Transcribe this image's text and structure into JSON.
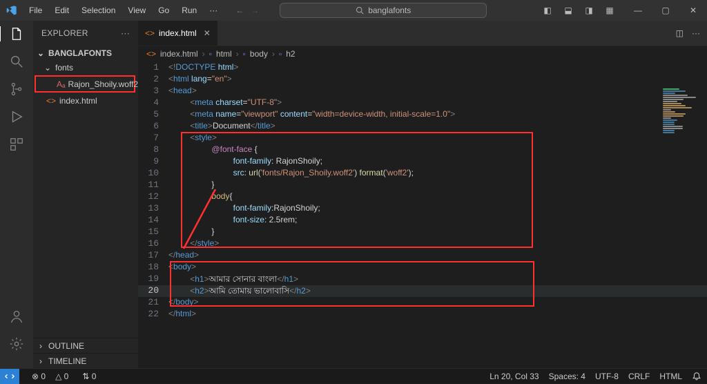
{
  "titlebar": {
    "menu": [
      "File",
      "Edit",
      "Selection",
      "View",
      "Go",
      "Run",
      "···"
    ],
    "search_label": "banglafonts"
  },
  "explorer": {
    "title": "EXPLORER",
    "project": "BANGLAFONTS",
    "folder": "fonts",
    "file1": "Rajon_Shoily.woff2",
    "file2": "index.html",
    "outline": "OUTLINE",
    "timeline": "TIMELINE"
  },
  "tab": {
    "name": "index.html"
  },
  "breadcrumb": {
    "a": "index.html",
    "b": "html",
    "c": "body",
    "d": "h2"
  },
  "code": {
    "l1": {
      "a": "<!",
      "b": "DOCTYPE",
      "c": " ",
      "d": "html",
      "e": ">"
    },
    "l2": {
      "a": "<",
      "b": "html",
      "c": " ",
      "d": "lang",
      "e": "=",
      "f": "\"en\"",
      "g": ">"
    },
    "l3": {
      "a": "<",
      "b": "head",
      "c": ">"
    },
    "l4": {
      "a": "<",
      "b": "meta",
      "c": " ",
      "d": "charset",
      "e": "=",
      "f": "\"UTF-8\"",
      "g": ">"
    },
    "l5": {
      "a": "<",
      "b": "meta",
      "c": " ",
      "d": "name",
      "e": "=",
      "f": "\"viewport\"",
      "g": " ",
      "h": "content",
      "i": "=",
      "j": "\"width=device-width, initial-scale=1.0\"",
      "k": ">"
    },
    "l6": {
      "a": "<",
      "b": "title",
      "c": ">",
      "d": "Document",
      "e": "</",
      "f": "title",
      "g": ">"
    },
    "l7": {
      "a": "<",
      "b": "style",
      "c": ">"
    },
    "l8": {
      "a": "@font-face",
      "b": " {"
    },
    "l9": {
      "a": "font-family",
      "b": ": RajonShoily;"
    },
    "l10": {
      "a": "src",
      "b": ": ",
      "c": "url",
      "d": "(",
      "e": "'fonts/Rajon_Shoily.woff2'",
      "f": ") ",
      "g": "format",
      "h": "(",
      "i": "'woff2'",
      "j": ");"
    },
    "l11": {
      "a": "}"
    },
    "l12": {
      "a": "body",
      "b": "{"
    },
    "l13": {
      "a": "font-family",
      "b": ":RajonShoily;"
    },
    "l14": {
      "a": "font-size",
      "b": ": ",
      "c": "2.5rem",
      "d": ";"
    },
    "l15": {
      "a": "}"
    },
    "l16": {
      "a": "</",
      "b": "style",
      "c": ">"
    },
    "l17": {
      "a": "</",
      "b": "head",
      "c": ">"
    },
    "l18": {
      "a": "<",
      "b": "body",
      "c": ">"
    },
    "l19": {
      "a": "<",
      "b": "h1",
      "c": ">",
      "d": "আমার সোনার বাংলা",
      "e": "</",
      "f": "h1",
      "g": ">"
    },
    "l20": {
      "a": "<",
      "b": "h2",
      "c": ">",
      "d": "আমি তোমায় ভালোবাসি",
      "e": "</",
      "f": "h2",
      "g": ">"
    },
    "l21": {
      "a": "</",
      "b": "body",
      "c": ">"
    },
    "l22": {
      "a": "</",
      "b": "html",
      "c": ">"
    }
  },
  "linenums": {
    "1": "1",
    "2": "2",
    "3": "3",
    "4": "4",
    "5": "5",
    "6": "6",
    "7": "7",
    "8": "8",
    "9": "9",
    "10": "10",
    "11": "11",
    "12": "12",
    "13": "13",
    "14": "14",
    "15": "15",
    "16": "16",
    "17": "17",
    "18": "18",
    "19": "19",
    "20": "20",
    "21": "21",
    "22": "22"
  },
  "status": {
    "errors": "0",
    "warnings": "0",
    "ports": "0",
    "pos": "Ln 20, Col 33",
    "spaces": "Spaces: 4",
    "enc": "UTF-8",
    "eol": "CRLF",
    "lang": "HTML"
  },
  "icons": {
    "err_label": "⊗",
    "warn_label": "△",
    "port_label": "⇅"
  }
}
